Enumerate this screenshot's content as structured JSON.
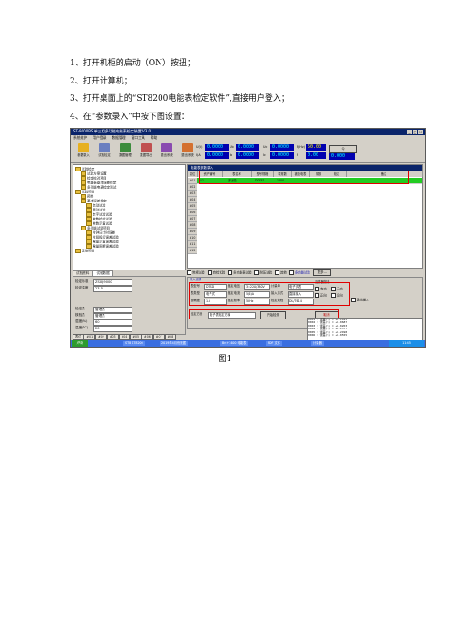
{
  "steps": [
    "1、打开机柜的启动（ON）按扭；",
    "2、打开计算机；",
    "3、打开桌面上的“ST8200电能表检定软件”,直接用户登入；",
    "4、在“参数录入”中按下图设置："
  ],
  "caption": "图1",
  "screenshot": {
    "title": "ST-9000BS 单三相多功能电能表检定装置 V3.0",
    "menu": [
      "系统维护",
      "用户登录",
      "数据管理",
      "窗口工具",
      "帮助"
    ],
    "toolbar": [
      "参数录入",
      "试验检定",
      "数据管理",
      "数据导出",
      "退出系统",
      "退出系统"
    ],
    "readouts": [
      {
        "label": "U(V)",
        "value": "0.0000"
      },
      {
        "label": "Ub",
        "value": "0.0000"
      },
      {
        "label": "Uc",
        "value": "0.0000"
      },
      {
        "label": "I(A)",
        "value": "0.0000"
      },
      {
        "label": "Ib",
        "value": "0.0000"
      },
      {
        "label": "Ic",
        "value": "0.0000"
      },
      {
        "label": "F(Hz)",
        "value": "50.00"
      },
      {
        "label": "P",
        "value": "0.00"
      },
      {
        "label": "Q",
        "value": "0.000"
      }
    ],
    "tree": [
      "试验检定",
      "试验方案设置",
      "检定校对项目",
      "电能表基本误差检定",
      "多功能电表检定测试",
      "试验项目",
      "预热",
      "基本误差检定",
      "启动试验",
      "潜动试验",
      "走字试验试验",
      "常数检验试验",
      "常数示值试验",
      "多功能试验项目",
      "时钟日计时误差",
      "时段投切误差试验",
      "需量示值误差试验",
      "需量周期误差试验",
      "其他项目"
    ],
    "left_tabs": [
      "试验资料",
      "试验数据"
    ],
    "left_fields": [
      {
        "label": "检定标准",
        "value": "ZSXJ-9000"
      },
      {
        "label": "检定温度",
        "value": "23.5"
      },
      {
        "label": "检定员",
        "value": "管理员"
      },
      {
        "label": "核验员",
        "value": "管理员"
      },
      {
        "label": "湿度(%)",
        "value": "60"
      },
      {
        "label": "温度(°C)",
        "value": "20"
      }
    ],
    "grid_title": "电能表参数录入",
    "grid_headers": [
      "表位",
      "资产编号",
      "表名称",
      "型号规格",
      "表常数",
      "被检电表",
      "常数",
      "检定",
      "备注"
    ],
    "grid_rows": [
      "#01",
      "#02",
      "#03",
      "#04",
      "#05",
      "#06",
      "#07",
      "#08",
      "#09",
      "#10",
      "#11",
      "#12"
    ],
    "grid_first_row": [
      "111",
      "多功能",
      "DDSF1",
      "1600",
      "",
      "",
      "",
      ""
    ],
    "checks": [
      "常规试验",
      "自检试验",
      "多功能表试验",
      "耐压试验",
      "其他",
      "多功能试验"
    ],
    "more_button": "更多...",
    "params_title": "录入设置",
    "params": [
      {
        "label": "表型号",
        "value": "DTSD"
      },
      {
        "label": "额定电压",
        "value": "3×220/380V"
      },
      {
        "label": "计量单",
        "value": "电子式表"
      },
      {
        "label": "表类型",
        "value": "电子式"
      },
      {
        "label": "额定电流",
        "value": "5(6)A"
      },
      {
        "label": "接入方式",
        "value": "直接接入"
      },
      {
        "label": "准确度",
        "value": "1.0"
      },
      {
        "label": "额定频率",
        "value": "50Hz"
      },
      {
        "label": "检定规程",
        "value": "DL/T614"
      }
    ],
    "params_right": [
      "互感器接法",
      "有功",
      "无功",
      "正向",
      "反向"
    ],
    "load_plan_label": "检定方案",
    "load_plan_value": "电子表检定方案",
    "buttons": {
      "start": "开始检测",
      "cancel": "取消",
      "close": "退出输入"
    },
    "bottom_tabs": [
      "表位",
      "#01",
      "#02",
      "#03",
      "#04",
      "#05",
      "#06",
      "#07",
      "#08",
      "#09",
      "#10",
      "#11",
      "#12"
    ],
    "bottom_rows": [
      "基本误差",
      "潜动试验",
      "启动试验"
    ],
    "log": [
      "0001 : 误差(%) = +0.1025",
      "0002 : 误差(%) = +0.0687",
      "0003 : 误差(%) = +0.0203",
      "0004 : 误差(%) = +0.1377",
      "0005 : 误差(%) = +0.2498",
      "0006 : 误差(%) = +0.0555"
    ],
    "taskbar": {
      "start": "开始",
      "tasks": [
        "ST8 ST8200",
        "2019年4月份数据",
        "Bn+1400 电能表",
        "PDF 文件",
        "计量器"
      ],
      "clock": "11:45"
    }
  }
}
